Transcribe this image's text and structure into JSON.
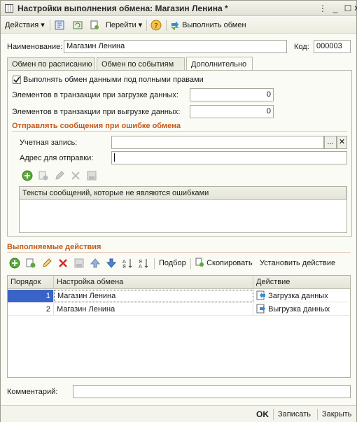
{
  "window": {
    "title": "Настройки выполнения обмена: Магазин Ленина *"
  },
  "toolbar": {
    "actions_label": "Действия",
    "goto_label": "Перейти",
    "run_exchange_label": "Выполнить обмен"
  },
  "form": {
    "name_label": "Наименование:",
    "name_value": "Магазин Ленина",
    "code_label": "Код:",
    "code_value": "000003"
  },
  "tabs": [
    {
      "label": "Обмен по расписанию"
    },
    {
      "label": "Обмен по событиям"
    },
    {
      "label": "Дополнительно"
    }
  ],
  "additional": {
    "full_rights_label": "Выполнять обмен данными под полными правами",
    "full_rights_checked": true,
    "load_items_label": "Элементов в транзакции при загрузке данных:",
    "load_items_value": "0",
    "unload_items_label": "Элементов в транзакции при выгрузке данных:",
    "unload_items_value": "0",
    "error_section_title": "Отправлять сообщения при ошибке обмена",
    "account_label": "Учетная запись:",
    "account_value": "",
    "address_label": "Адрес для отправки:",
    "address_value": "",
    "messages_column": "Тексты сообщений, которые не являются ошибками",
    "ellipsis_label": "...",
    "clear_label": "✕"
  },
  "actions_section": {
    "title": "Выполняемые действия",
    "select_label": "Подбор",
    "copy_label": "Скопировать",
    "set_action_label": "Установить действие",
    "columns": {
      "order": "Порядок",
      "setting": "Настройка обмена",
      "action": "Действие"
    },
    "rows": [
      {
        "order": "1",
        "setting": "Магазин Ленина",
        "action": "Загрузка данных",
        "selected": true
      },
      {
        "order": "2",
        "setting": "Магазин Ленина",
        "action": "Выгрузка данных",
        "selected": false
      }
    ]
  },
  "comment": {
    "label": "Комментарий:",
    "value": ""
  },
  "bottom": {
    "ok_label": "OK",
    "save_label": "Записать",
    "close_label": "Закрыть"
  },
  "colors": {
    "accent": "#c7591c",
    "selection": "#3a63c8"
  }
}
